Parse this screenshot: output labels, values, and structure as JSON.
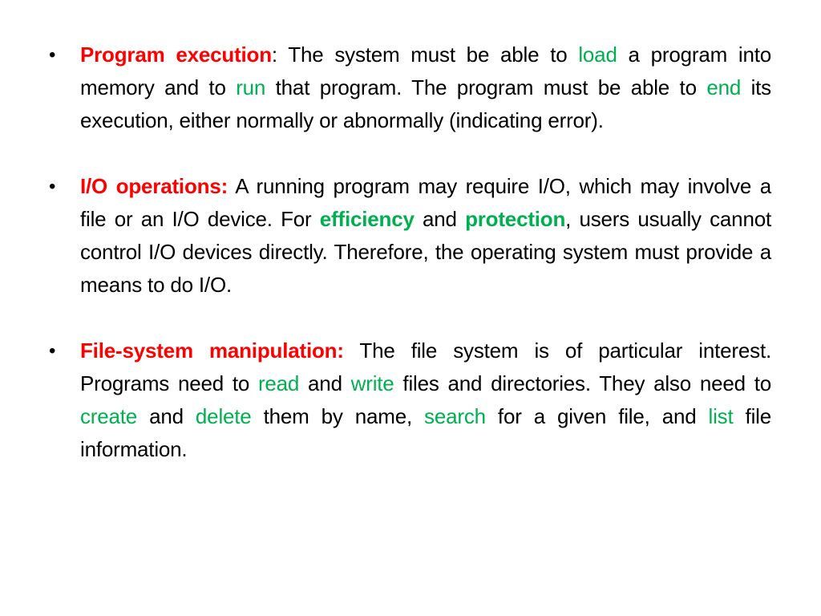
{
  "colors": {
    "heading": "#ff0000",
    "keyword": "#00b050",
    "text": "#000000",
    "background": "#ffffff"
  },
  "bullet_glyph": "•",
  "items": [
    {
      "heading": "Program execution",
      "segments": [
        {
          "text": "Program execution",
          "style": "heading"
        },
        {
          "text": ": The system must be able to ",
          "style": "text"
        },
        {
          "text": "load",
          "style": "keyword"
        },
        {
          "text": " a program into memory and to ",
          "style": "text"
        },
        {
          "text": "run",
          "style": "keyword"
        },
        {
          "text": " that program. The program must be able to ",
          "style": "text"
        },
        {
          "text": "end",
          "style": "keyword"
        },
        {
          "text": " its execution, either normally or abnormally (indicating error).",
          "style": "text"
        }
      ]
    },
    {
      "heading": "I/O operations:",
      "segments": [
        {
          "text": "I/O operations:",
          "style": "heading"
        },
        {
          "text": "  A running program may require I/O, which may involve a file or an I/O device. For ",
          "style": "text"
        },
        {
          "text": "efficiency",
          "style": "keyword-bold"
        },
        {
          "text": " and ",
          "style": "text"
        },
        {
          "text": "protection",
          "style": "keyword-bold"
        },
        {
          "text": ", users usually cannot control I/O devices directly. Therefore, the operating system must provide a means to do I/O.",
          "style": "text"
        }
      ]
    },
    {
      "heading": "File-system manipulation:",
      "segments": [
        {
          "text": "File-system manipulation:",
          "style": "heading"
        },
        {
          "text": "  The file system is of particular interest. Programs need to ",
          "style": "text"
        },
        {
          "text": "read",
          "style": "keyword"
        },
        {
          "text": " and ",
          "style": "text"
        },
        {
          "text": "write",
          "style": "keyword"
        },
        {
          "text": " files and directories. They also need to ",
          "style": "text"
        },
        {
          "text": "create",
          "style": "keyword"
        },
        {
          "text": " and ",
          "style": "text"
        },
        {
          "text": "delete",
          "style": "keyword"
        },
        {
          "text": " them by name, ",
          "style": "text"
        },
        {
          "text": "search",
          "style": "keyword"
        },
        {
          "text": " for a given file, and ",
          "style": "text"
        },
        {
          "text": "list",
          "style": "keyword"
        },
        {
          "text": " file information.",
          "style": "text"
        }
      ]
    }
  ]
}
